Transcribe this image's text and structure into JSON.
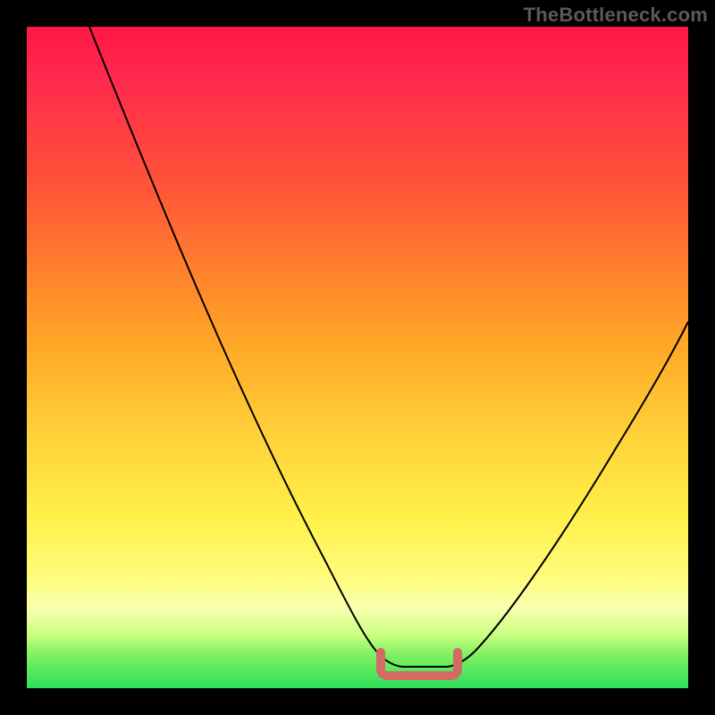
{
  "watermark": "TheBottleneck.com",
  "colors": {
    "gradient_top": "#ff1744",
    "gradient_mid": "#ffd23a",
    "gradient_bottom": "#2ee05a",
    "curve": "#000000",
    "bracket": "#d36a65",
    "background": "#000000"
  },
  "chart_data": {
    "type": "line",
    "title": "",
    "xlabel": "",
    "ylabel": "",
    "xlim": [
      0,
      100
    ],
    "ylim": [
      0,
      100
    ],
    "grid": false,
    "legend": false,
    "note": "Values are approximate — read as percent of plot width (x) and percent of plot height from bottom (y). The curve is a V-shaped bottleneck well; the pink bracket marks the flat minimum region.",
    "series": [
      {
        "name": "bottleneck-curve",
        "x": [
          10,
          15,
          20,
          25,
          30,
          35,
          40,
          45,
          50,
          53,
          55,
          57,
          60,
          62,
          65,
          70,
          75,
          80,
          85,
          90,
          95,
          100
        ],
        "y": [
          100,
          90,
          80,
          70,
          60,
          50,
          40,
          30,
          20,
          12,
          8,
          6,
          5,
          5,
          6,
          10,
          18,
          27,
          36,
          45,
          52,
          58
        ]
      },
      {
        "name": "optimal-range-bracket",
        "x": [
          53,
          65
        ],
        "y": [
          4,
          4
        ]
      }
    ]
  }
}
